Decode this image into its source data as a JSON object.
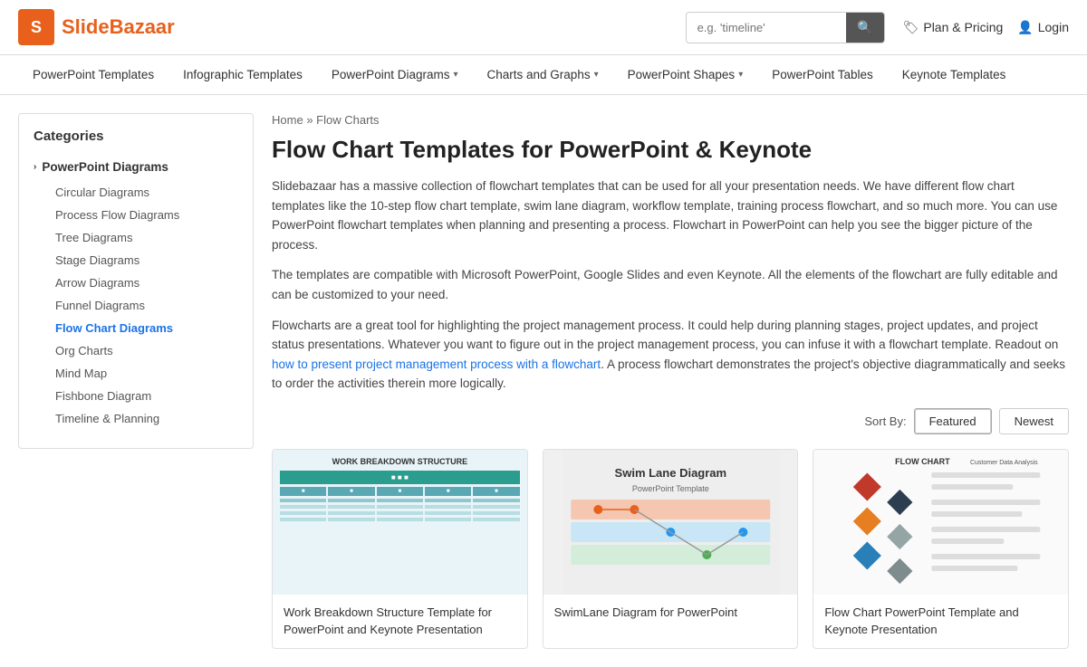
{
  "header": {
    "logo_letter": "S",
    "logo_name_part1": "Slide",
    "logo_name_part2": "Bazaar",
    "search_placeholder": "e.g. 'timeline'",
    "plan_pricing_label": "Plan & Pricing",
    "login_label": "Login"
  },
  "navbar": {
    "items": [
      {
        "label": "PowerPoint Templates",
        "has_dropdown": false
      },
      {
        "label": "Infographic Templates",
        "has_dropdown": false
      },
      {
        "label": "PowerPoint Diagrams",
        "has_dropdown": true
      },
      {
        "label": "Charts and Graphs",
        "has_dropdown": true
      },
      {
        "label": "PowerPoint Shapes",
        "has_dropdown": true
      },
      {
        "label": "PowerPoint Tables",
        "has_dropdown": false
      },
      {
        "label": "Keynote Templates",
        "has_dropdown": false
      }
    ]
  },
  "sidebar": {
    "title": "Categories",
    "sections": [
      {
        "label": "PowerPoint Diagrams",
        "sub_items": [
          {
            "label": "Circular Diagrams",
            "active": false
          },
          {
            "label": "Process Flow Diagrams",
            "active": false
          },
          {
            "label": "Tree Diagrams",
            "active": false
          },
          {
            "label": "Stage Diagrams",
            "active": false
          },
          {
            "label": "Arrow Diagrams",
            "active": false
          },
          {
            "label": "Funnel Diagrams",
            "active": false
          },
          {
            "label": "Flow Chart Diagrams",
            "active": true
          },
          {
            "label": "Org Charts",
            "active": false
          },
          {
            "label": "Mind Map",
            "active": false
          },
          {
            "label": "Fishbone Diagram",
            "active": false
          },
          {
            "label": "Timeline & Planning",
            "active": false
          }
        ]
      }
    ]
  },
  "breadcrumb": {
    "home": "Home",
    "separator": "»",
    "current": "Flow Charts"
  },
  "page": {
    "title": "Flow Chart Templates for PowerPoint & Keynote",
    "description1": "Slidebazaar has a massive collection of flowchart templates that can be used for all your presentation needs. We have different flow chart templates like the 10-step flow chart template, swim lane diagram, workflow template, training process flowchart, and so much more. You can use PowerPoint flowchart templates when planning and presenting a process. Flowchart in PowerPoint can help you see the bigger picture of the process.",
    "description2": "The templates are compatible with Microsoft PowerPoint, Google Slides and even Keynote. All the elements of the flowchart are fully editable and can be customized to your need.",
    "description3_pre": "Flowcharts are a great tool for highlighting the project management process. It could help during planning stages, project updates, and project status presentations. Whatever you want to figure out in the project management process, you can infuse it with a flowchart template. Readout on ",
    "description3_link": "how to present project management process with a flowchart",
    "description3_post": ". A process flowchart demonstrates the project's objective diagrammatically and seeks to order the activities therein more logically."
  },
  "sort": {
    "label": "Sort By:",
    "featured": "Featured",
    "newest": "Newest"
  },
  "cards": [
    {
      "title": "Work Breakdown Structure Template for PowerPoint and Keynote Presentation",
      "image_type": "wbs"
    },
    {
      "title": "SwimLane Diagram for PowerPoint",
      "image_type": "swimlane"
    },
    {
      "title": "Flow Chart PowerPoint Template and Keynote Presentation",
      "image_type": "flowchart"
    }
  ]
}
